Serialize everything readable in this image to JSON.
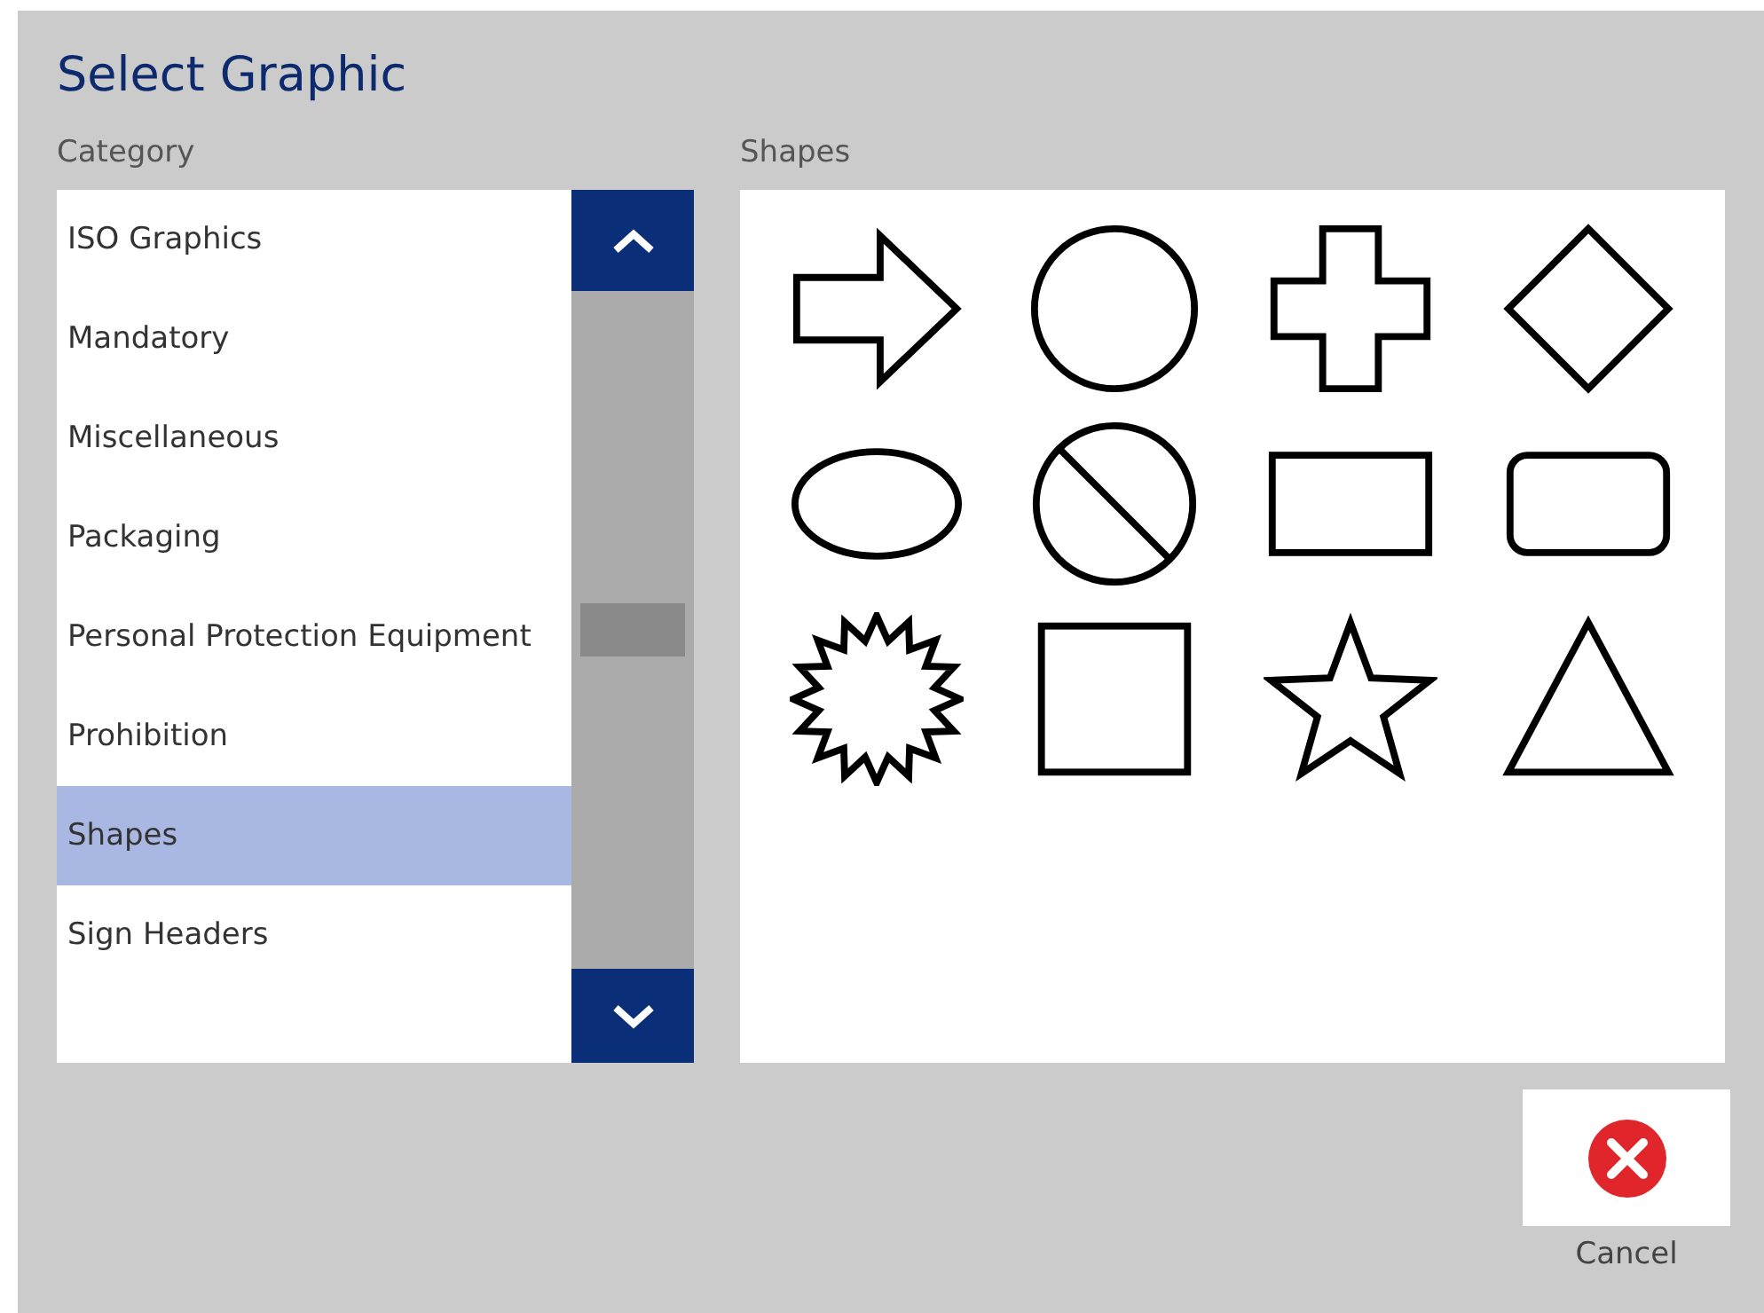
{
  "title": "Select Graphic",
  "category": {
    "label": "Category",
    "items": [
      {
        "label": "ISO Graphics",
        "selected": false
      },
      {
        "label": "Mandatory",
        "selected": false
      },
      {
        "label": "Miscellaneous",
        "selected": false
      },
      {
        "label": "Packaging",
        "selected": false
      },
      {
        "label": "Personal Protection Equipment",
        "selected": false
      },
      {
        "label": "Prohibition",
        "selected": false
      },
      {
        "label": "Shapes",
        "selected": true
      },
      {
        "label": "Sign Headers",
        "selected": false
      }
    ]
  },
  "graphics": {
    "label": "Shapes",
    "items": [
      {
        "kind": "arrow"
      },
      {
        "kind": "circle"
      },
      {
        "kind": "cross"
      },
      {
        "kind": "diamond"
      },
      {
        "kind": "ellipse"
      },
      {
        "kind": "prohibition"
      },
      {
        "kind": "rectangle"
      },
      {
        "kind": "rounded-rectangle"
      },
      {
        "kind": "starburst"
      },
      {
        "kind": "square"
      },
      {
        "kind": "star"
      },
      {
        "kind": "triangle"
      }
    ]
  },
  "cancel_button": {
    "label": "Cancel"
  }
}
